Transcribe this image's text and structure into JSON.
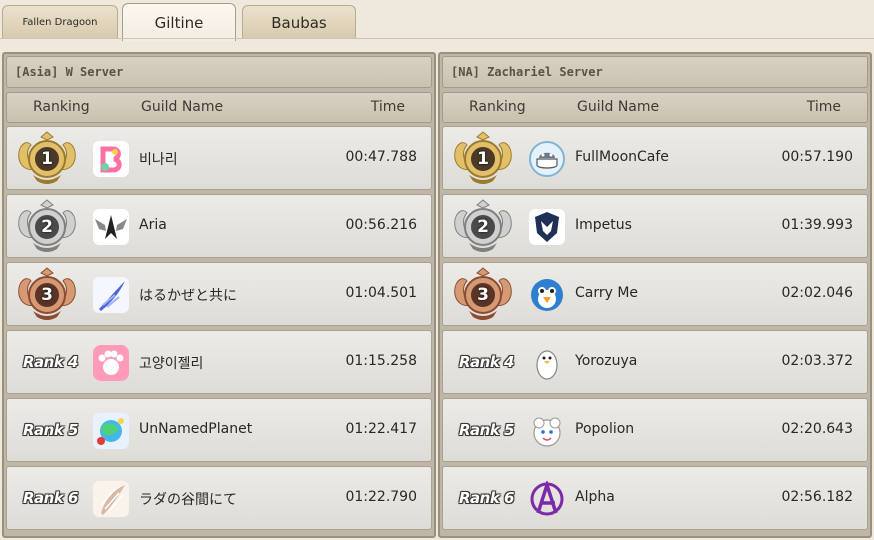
{
  "tabs": [
    {
      "label": "Fallen Dragoon",
      "active": false
    },
    {
      "label": "Giltine",
      "active": true
    },
    {
      "label": "Baubas",
      "active": false
    }
  ],
  "columns": {
    "ranking": "Ranking",
    "guild": "Guild Name",
    "time": "Time"
  },
  "colors": {
    "gold": "#c9a24a",
    "silver": "#9c9c9c",
    "bronze": "#a86a4a"
  },
  "servers": [
    {
      "title": "[Asia] W Server",
      "rows": [
        {
          "rank": "1",
          "rank_label": "",
          "guild": "비나리",
          "time": "00:47.788",
          "icon": "binari-logo-icon"
        },
        {
          "rank": "2",
          "rank_label": "",
          "guild": "Aria",
          "time": "00:56.216",
          "icon": "aria-wings-icon"
        },
        {
          "rank": "3",
          "rank_label": "",
          "guild": "はるかぜと共に",
          "time": "01:04.501",
          "icon": "feather-wing-icon"
        },
        {
          "rank": "4",
          "rank_label": "Rank 4",
          "guild": "고양이젤리",
          "time": "01:15.258",
          "icon": "paw-icon"
        },
        {
          "rank": "5",
          "rank_label": "Rank 5",
          "guild": "UnNamedPlanet",
          "time": "01:22.417",
          "icon": "planet-icon"
        },
        {
          "rank": "6",
          "rank_label": "Rank 6",
          "guild": "ラダの谷間にて",
          "time": "01:22.790",
          "icon": "feather-icon"
        }
      ]
    },
    {
      "title": "[NA] Zachariel Server",
      "rows": [
        {
          "rank": "1",
          "rank_label": "",
          "guild": "FullMoonCafe",
          "time": "00:57.190",
          "icon": "moon-cafe-icon"
        },
        {
          "rank": "2",
          "rank_label": "",
          "guild": "Impetus",
          "time": "01:39.993",
          "icon": "wolf-emblem-icon"
        },
        {
          "rank": "3",
          "rank_label": "",
          "guild": "Carry Me",
          "time": "02:02.046",
          "icon": "penguin-icon"
        },
        {
          "rank": "4",
          "rank_label": "Rank 4",
          "guild": "Yorozuya",
          "time": "02:03.372",
          "icon": "white-penguin-icon"
        },
        {
          "rank": "5",
          "rank_label": "Rank 5",
          "guild": "Popolion",
          "time": "02:20.643",
          "icon": "popolion-icon"
        },
        {
          "rank": "6",
          "rank_label": "Rank 6",
          "guild": "Alpha",
          "time": "02:56.182",
          "icon": "anarchy-a-icon"
        }
      ]
    }
  ]
}
